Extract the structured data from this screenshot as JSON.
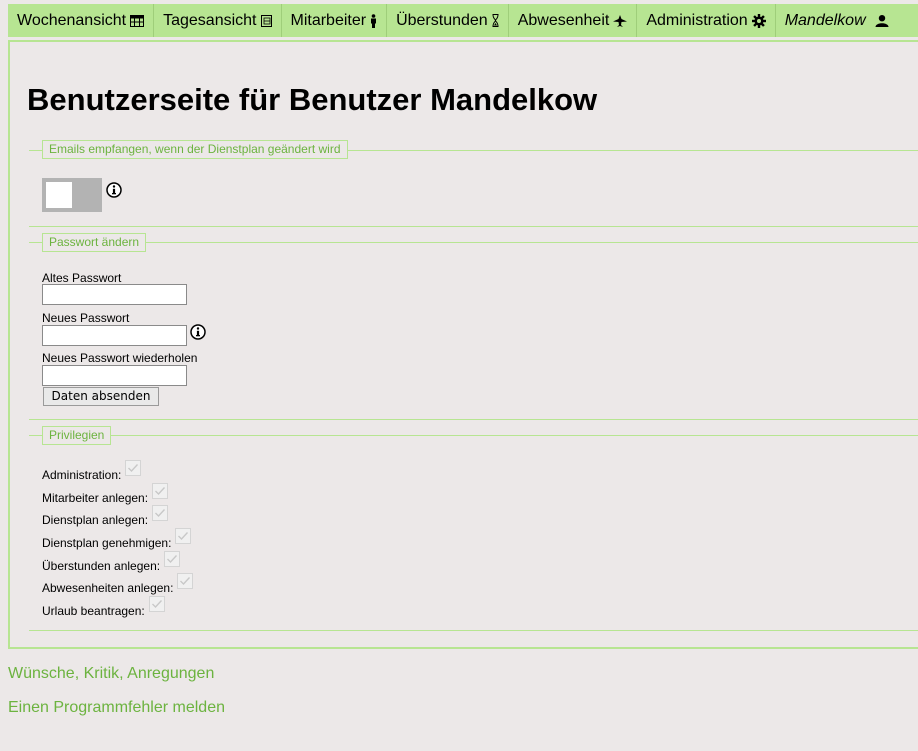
{
  "nav": {
    "items": [
      {
        "label": "Wochenansicht",
        "icon": "calendar-grid-icon"
      },
      {
        "label": "Tagesansicht",
        "icon": "day-view-icon"
      },
      {
        "label": "Mitarbeiter",
        "icon": "person-icon"
      },
      {
        "label": "Überstunden",
        "icon": "hourglass-icon"
      },
      {
        "label": "Abwesenheit",
        "icon": "plane-icon"
      },
      {
        "label": "Administration",
        "icon": "gear-icon"
      }
    ],
    "user": {
      "label": "Mandelkow",
      "icon": "user-icon"
    }
  },
  "page": {
    "title": "Benutzerseite für Benutzer Mandelkow"
  },
  "email_section": {
    "legend": "Emails empfangen, wenn der Dienstplan geändert wird",
    "toggle_on": false
  },
  "password_section": {
    "legend": "Passwort ändern",
    "old_label": "Altes Passwort",
    "old_value": "",
    "new_label": "Neues Passwort",
    "new_value": "",
    "repeat_label": "Neues Passwort wiederholen",
    "repeat_value": "",
    "submit_label": "Daten absenden"
  },
  "privileges_section": {
    "legend": "Privilegien",
    "items": [
      {
        "label": "Administration:",
        "checked": true
      },
      {
        "label": "Mitarbeiter anlegen:",
        "checked": true
      },
      {
        "label": "Dienstplan anlegen:",
        "checked": true
      },
      {
        "label": "Dienstplan genehmigen:",
        "checked": true
      },
      {
        "label": "Überstunden anlegen:",
        "checked": true
      },
      {
        "label": "Abwesenheiten anlegen:",
        "checked": true
      },
      {
        "label": "Urlaub beantragen:",
        "checked": true
      }
    ]
  },
  "footer": {
    "feedback_link": "Wünsche, Kritik, Anregungen",
    "bug_link": "Einen Programmfehler melden"
  },
  "colors": {
    "accent_green": "#b7e592",
    "link_green": "#6cb33f",
    "background": "#ece8e8"
  }
}
